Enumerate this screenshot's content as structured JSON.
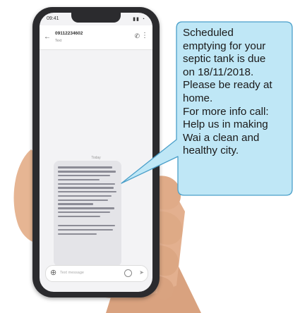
{
  "phone": {
    "status_time": "09:41",
    "sender_number": "09112234602",
    "sender_sub": "Text",
    "date_label": "Today",
    "compose_placeholder": "Text message",
    "screen_color": "#f3f3f5",
    "bubble_color": "#e4e4e8"
  },
  "callout": {
    "fill_color": "#bfe7f6",
    "border_color": "#4a9fc9",
    "lines": [
      "Scheduled",
      "emptying for your",
      "septic tank is due",
      "on 18/11/2018.",
      "Please be ready at",
      "home.",
      "For more info call:",
      "Help us in making",
      "Wai a clean and",
      "healthy city."
    ]
  }
}
